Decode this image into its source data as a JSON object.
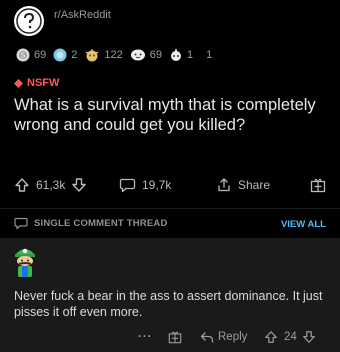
{
  "post": {
    "subreddit": "r/AskReddit",
    "awards": [
      {
        "icon": "silver-award-icon",
        "count": "69"
      },
      {
        "icon": "helpful-award-icon",
        "count": "2"
      },
      {
        "icon": "starstruck-award-icon",
        "count": "122"
      },
      {
        "icon": "wholesome-award-icon",
        "count": "69"
      },
      {
        "icon": "rocket-award-icon",
        "count": "1"
      },
      {
        "icon": "",
        "count": "1"
      }
    ],
    "nsfw_label": "NSFW",
    "title": "What is a survival myth that is completely wrong and could get you killed?",
    "upvotes": "61,3k",
    "comments": "19,7k",
    "share_label": "Share"
  },
  "thread": {
    "label": "SINGLE COMMENT THREAD",
    "view_all": "VIEW ALL"
  },
  "comment": {
    "text": "Never fuck a bear in the ass to assert dominance. It just pisses it off even more.",
    "more": "···",
    "reply_label": "Reply",
    "score": "24"
  },
  "colors": {
    "background": "#000000",
    "comment_bg": "#1a1a1b",
    "nsfw": "#ff585b",
    "link": "#4fbcff"
  }
}
